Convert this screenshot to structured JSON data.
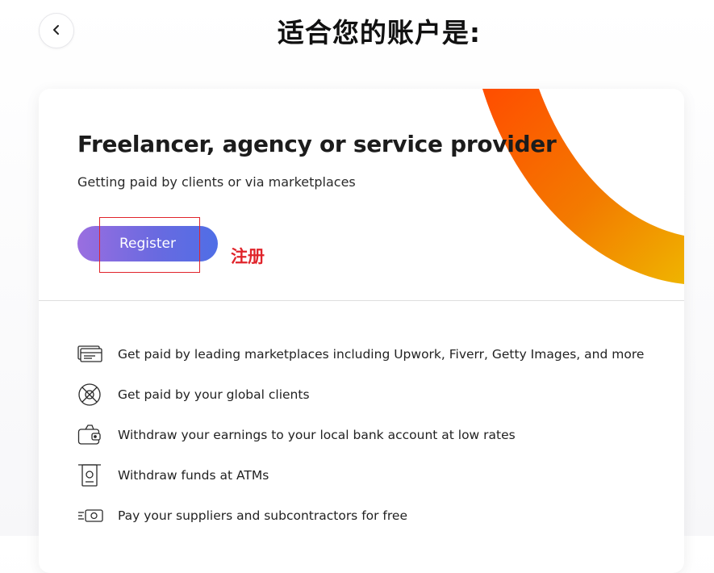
{
  "header": {
    "back_icon": "chevron-left-icon",
    "title": "适合您的账户是:"
  },
  "card": {
    "title": "Freelancer, agency or service provider",
    "subtitle": "Getting paid by clients or via marketplaces",
    "register_label": "Register",
    "annotation": "注册",
    "colors": {
      "button_start": "#9a6ee0",
      "button_end": "#4f6ee6",
      "annotation": "#e0242b",
      "arc_start": "#ff4d00",
      "arc_end": "#f0b400"
    }
  },
  "features": [
    {
      "icon": "marketplace-cards-icon",
      "text": "Get paid by leading marketplaces including Upwork, Fiverr, Getty Images, and more"
    },
    {
      "icon": "globe-icon",
      "text": "Get paid by your global clients"
    },
    {
      "icon": "wallet-icon",
      "text": "Withdraw your earnings to your local bank account at low rates"
    },
    {
      "icon": "atm-icon",
      "text": "Withdraw funds at ATMs"
    },
    {
      "icon": "cash-transfer-icon",
      "text": "Pay your suppliers and subcontractors for free"
    }
  ]
}
